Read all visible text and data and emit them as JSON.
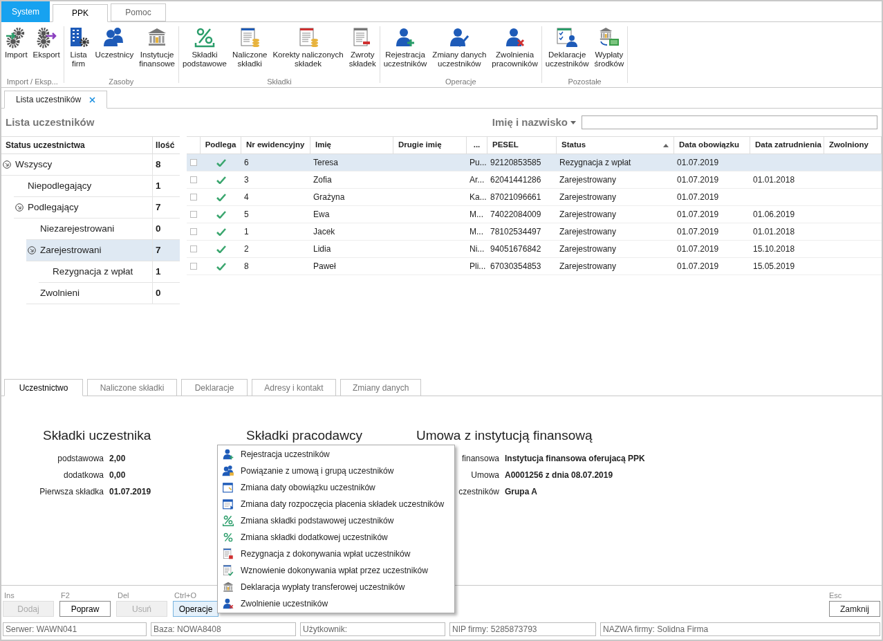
{
  "system_button": {
    "label": "System"
  },
  "tabs": [
    {
      "label": "PPK",
      "selected": true
    },
    {
      "label": "Pomoc",
      "selected": false
    }
  ],
  "ribbon": [
    {
      "label": "Import / Eksp...",
      "buttons": [
        "Import",
        "Eksport"
      ]
    },
    {
      "label": "Zasoby",
      "buttons": [
        "Lista\nfirm",
        "Uczestnicy",
        "Instytucje\nfinansowe"
      ]
    },
    {
      "label": "Składki",
      "buttons": [
        "Składki\npodstawowe",
        "Naliczone\nskładki",
        "Korekty naliczonych\nskładek",
        "Zwroty\nskładek"
      ]
    },
    {
      "label": "Operacje",
      "buttons": [
        "Rejestracja\nuczestników",
        "Zmiany danych\nuczestników",
        "Zwolnienia\npracowników"
      ]
    },
    {
      "label": "Pozostałe",
      "buttons": [
        "Deklaracje\nuczestników",
        "Wypłaty\nśrodków"
      ]
    }
  ],
  "document_tabs": [
    {
      "label": "Lista uczestników",
      "selected": true
    }
  ],
  "page_title": "Lista uczestników",
  "search": {
    "label": "Imię i nazwisko"
  },
  "status_tree": {
    "columns": [
      "Status uczestnictwa",
      "Ilość"
    ],
    "items": [
      {
        "label": "Wszyscy",
        "count": "8",
        "selected": false,
        "expanded": true,
        "children": [
          {
            "label": "Niepodlegający",
            "count": "1",
            "selected": false
          },
          {
            "label": "Podlegający",
            "count": "7",
            "selected": false,
            "expanded": true,
            "children": [
              {
                "label": "Niezarejestrowani",
                "count": "0",
                "selected": false
              },
              {
                "label": "Zarejestrowani",
                "count": "7",
                "selected": true,
                "expanded": true,
                "children": [
                  {
                    "label": "Rezygnacja z wpłat",
                    "count": "1",
                    "selected": false
                  }
                ]
              },
              {
                "label": "Zwolnieni",
                "count": "0",
                "selected": false
              }
            ]
          }
        ]
      }
    ]
  },
  "table": {
    "columns": [
      "Podlega",
      "Nr ewidencyjny",
      "Imię",
      "Drugie imię",
      "...",
      "PESEL",
      "Status",
      "Data obowiązku",
      "Data zatrudnienia",
      "Zwolniony"
    ],
    "rows": [
      {
        "selected": true,
        "checked": false,
        "podlega": true,
        "cells": [
          "",
          "6",
          "Teresa",
          "",
          "Pu...",
          "92120853585",
          "Rezygnacja z wpłat",
          "01.07.2019",
          "",
          ""
        ]
      },
      {
        "selected": false,
        "checked": false,
        "podlega": true,
        "cells": [
          "",
          "3",
          "Zofia",
          "",
          "Ar...",
          "62041441286",
          "Zarejestrowany",
          "01.07.2019",
          "01.01.2018",
          ""
        ]
      },
      {
        "selected": false,
        "checked": false,
        "podlega": true,
        "cells": [
          "",
          "4",
          "Grażyna",
          "",
          "Ka...",
          "87021096661",
          "Zarejestrowany",
          "01.07.2019",
          "",
          ""
        ]
      },
      {
        "selected": false,
        "checked": false,
        "podlega": true,
        "cells": [
          "",
          "5",
          "Ewa",
          "",
          "M...",
          "74022084009",
          "Zarejestrowany",
          "01.07.2019",
          "01.06.2019",
          ""
        ]
      },
      {
        "selected": false,
        "checked": false,
        "podlega": true,
        "cells": [
          "",
          "1",
          "Jacek",
          "",
          "M...",
          "78102534497",
          "Zarejestrowany",
          "01.07.2019",
          "01.01.2018",
          ""
        ]
      },
      {
        "selected": false,
        "checked": false,
        "podlega": true,
        "cells": [
          "",
          "2",
          "Lidia",
          "",
          "Ni...",
          "94051676842",
          "Zarejestrowany",
          "01.07.2019",
          "15.10.2018",
          ""
        ]
      },
      {
        "selected": false,
        "checked": false,
        "podlega": true,
        "cells": [
          "",
          "8",
          "Paweł",
          "",
          "Pli...",
          "67030354853",
          "Zarejestrowany",
          "01.07.2019",
          "15.05.2019",
          ""
        ]
      }
    ]
  },
  "detail_tabs": [
    {
      "label": "Uczestnictwo",
      "selected": true
    },
    {
      "label": "Naliczone składki",
      "selected": false
    },
    {
      "label": "Deklaracje",
      "selected": false
    },
    {
      "label": "Adresy i kontakt",
      "selected": false
    },
    {
      "label": "Zmiany danych",
      "selected": false
    }
  ],
  "sections": [
    {
      "title": "Składki uczestnika",
      "fields": [
        {
          "label": "podstawowa",
          "value": "2,00"
        },
        {
          "label": "dodatkowa",
          "value": "0,00"
        },
        {
          "label": "Pierwsza składka",
          "value": "01.07.2019"
        }
      ]
    },
    {
      "title": "Składki pracodawcy"
    },
    {
      "title": "Umowa z instytucją finansową",
      "fields": [
        {
          "label": "finansowa",
          "value": "Instytucja finansowa oferujacą PPK"
        },
        {
          "label": "Umowa",
          "value": "A0001256 z dnia 08.07.2019"
        },
        {
          "label": "czestników",
          "value": "Grupa A"
        }
      ]
    }
  ],
  "context_menu": [
    "Rejestracja uczestników",
    "Powiązanie z umową i grupą uczestników",
    "Zmiana daty obowiązku uczestników",
    "Zmiana daty rozpoczęcia płacenia składek uczestników",
    "Zmiana składki podstawowej uczestników",
    "Zmiana składki dodatkowej uczestników",
    "Rezygnacja z dokonywania wpłat uczestników",
    "Wznowienie dokonywania wpłat przez uczestników",
    "Deklaracja wypłaty transferowej uczestników",
    "Zwolnienie uczestników"
  ],
  "buttons": [
    {
      "shortcut": "Ins",
      "label": "Dodaj",
      "disabled": true,
      "focused": false
    },
    {
      "shortcut": "F2",
      "label": "Popraw",
      "disabled": false,
      "focused": false
    },
    {
      "shortcut": "Del",
      "label": "Usuń",
      "disabled": true,
      "focused": false
    },
    {
      "shortcut": "Ctrl+O",
      "label": "Operacje",
      "disabled": false,
      "focused": true
    }
  ],
  "close_button": {
    "shortcut": "Esc",
    "label": "Zamknij"
  },
  "status_bar": [
    "Serwer: WAWN041",
    "Baza: NOWA8408",
    "Użytkownik:",
    "NIP firmy: 5285873793",
    "NAZWA firmy: Solidna Firma"
  ]
}
